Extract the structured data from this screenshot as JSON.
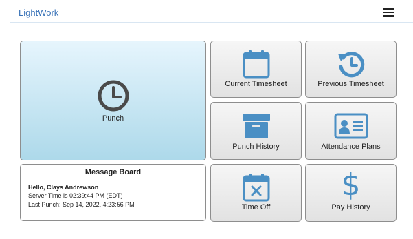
{
  "app": {
    "title": "LightWork"
  },
  "icons": {
    "menu": "hamburger-icon"
  },
  "tiles": {
    "punch": {
      "label": "Punch",
      "icon": "clock-icon"
    },
    "current_timesheet": {
      "label": "Current Timesheet",
      "icon": "calendar-icon"
    },
    "previous_timesheet": {
      "label": "Previous Timesheet",
      "icon": "history-icon"
    },
    "punch_history": {
      "label": "Punch History",
      "icon": "archive-box-icon"
    },
    "attendance_plans": {
      "label": "Attendance Plans",
      "icon": "id-card-icon"
    },
    "time_off": {
      "label": "Time Off",
      "icon": "calendar-x-icon"
    },
    "pay_history": {
      "label": "Pay History",
      "icon": "dollar-icon"
    }
  },
  "message_board": {
    "title": "Message Board",
    "greeting": "Hello, Clays Andrewson",
    "server_time": "Server Time is 02:39:44 PM (EDT)",
    "last_punch": "Last Punch: Sep 14, 2022, 4:23:56 PM"
  },
  "colors": {
    "brand": "#3a73b8",
    "icon_blue": "#4a8fc4",
    "punch_tile_top": "#e6f5fd",
    "punch_tile_bottom": "#add9ea"
  }
}
